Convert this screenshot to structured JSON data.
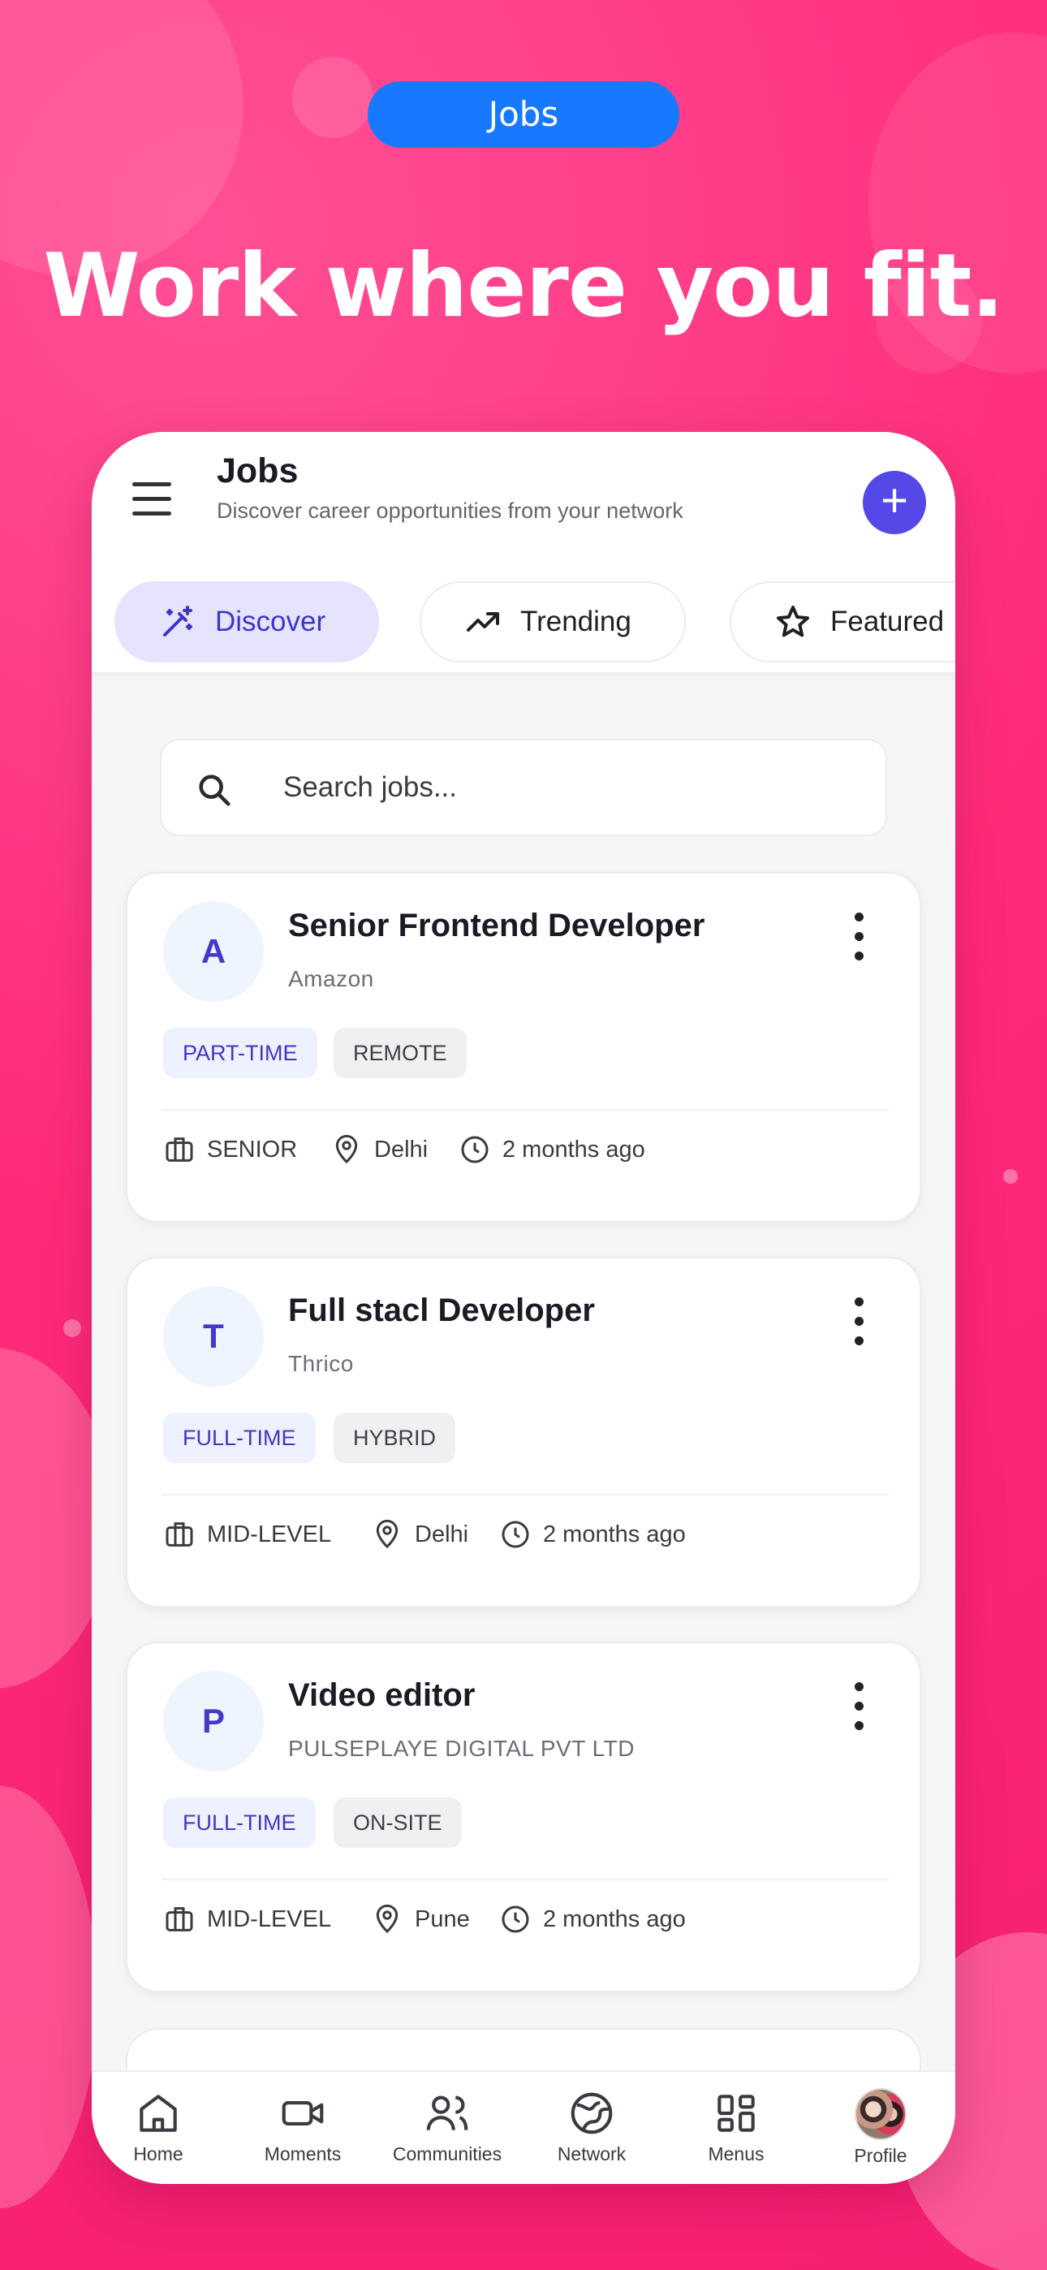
{
  "promo": {
    "pill_label": "Jobs",
    "headline": "Work where you fit."
  },
  "appbar": {
    "title": "Jobs",
    "subtitle": "Discover career opportunities from your network",
    "tabs": [
      "Discover",
      "Trending",
      "Featured"
    ],
    "active_tab": "Discover"
  },
  "search": {
    "placeholder": "Search jobs..."
  },
  "jobs": [
    {
      "initial": "A",
      "title": "Senior Frontend Developer",
      "company": "Amazon",
      "type": "PART-TIME",
      "mode": "REMOTE",
      "level": "SENIOR",
      "location": "Delhi",
      "posted": "2 months ago"
    },
    {
      "initial": "T",
      "title": "Full stacl Developer",
      "company": "Thrico",
      "type": "FULL-TIME",
      "mode": "HYBRID",
      "level": "MID-LEVEL",
      "location": "Delhi",
      "posted": "2 months ago"
    },
    {
      "initial": "P",
      "title": "Video editor",
      "company": "PULSEPLAYE DIGITAL PVT LTD",
      "type": "FULL-TIME",
      "mode": "ON-SITE",
      "level": "MID-LEVEL",
      "location": "Pune",
      "posted": "2 months ago"
    }
  ],
  "bottom_nav": [
    "Home",
    "Moments",
    "Communities",
    "Network",
    "Menus",
    "Profile"
  ],
  "colors": {
    "background": "#ff2f7f",
    "pill": "#1779ff",
    "accent": "#5448e6",
    "active_tab_bg": "#e6e3ff"
  }
}
